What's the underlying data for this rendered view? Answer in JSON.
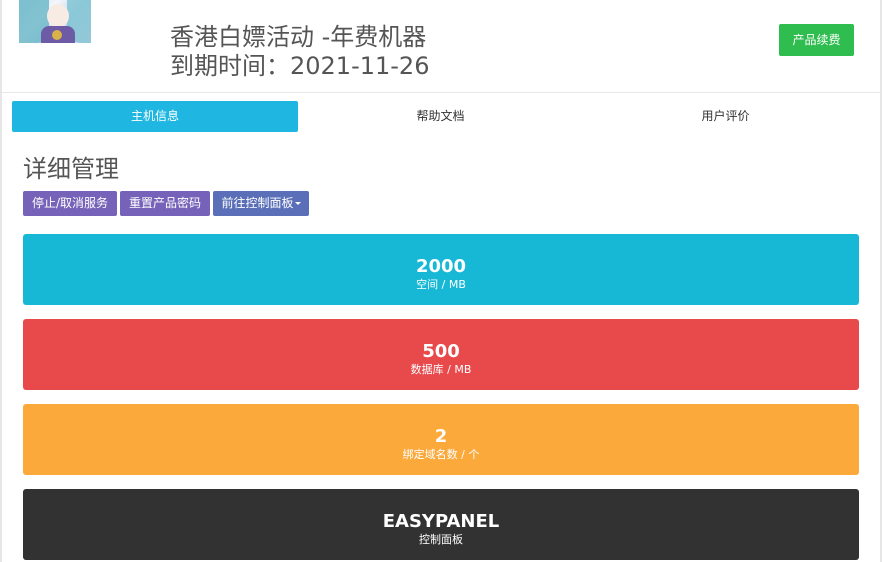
{
  "header": {
    "title": "香港白嫖活动 -年费机器",
    "expiry": "到期时间：2021-11-26",
    "renew_label": "产品续费"
  },
  "tabs": [
    {
      "label": "主机信息",
      "active": true
    },
    {
      "label": "帮助文档",
      "active": false
    },
    {
      "label": "用户评价",
      "active": false
    }
  ],
  "section": {
    "title": "详细管理",
    "actions": [
      {
        "label": "停止/取消服务"
      },
      {
        "label": "重置产品密码"
      },
      {
        "label": "前往控制面板",
        "has_dropdown": true
      }
    ]
  },
  "stats": [
    {
      "value": "2000",
      "label": "空间 / MB",
      "color": "#17b8d6"
    },
    {
      "value": "500",
      "label": "数据库 / MB",
      "color": "#e84a4b"
    },
    {
      "value": "2",
      "label": "绑定域名数 / 个",
      "color": "#fca93c"
    },
    {
      "value": "EASYPANEL",
      "label": "控制面板",
      "color": "#323232"
    }
  ],
  "colors": {
    "tab_active": "#1fb7e2",
    "renew_button": "#2ebd4e",
    "action_button": "#7662b8",
    "action_button_dropdown": "#5a6fb8"
  }
}
